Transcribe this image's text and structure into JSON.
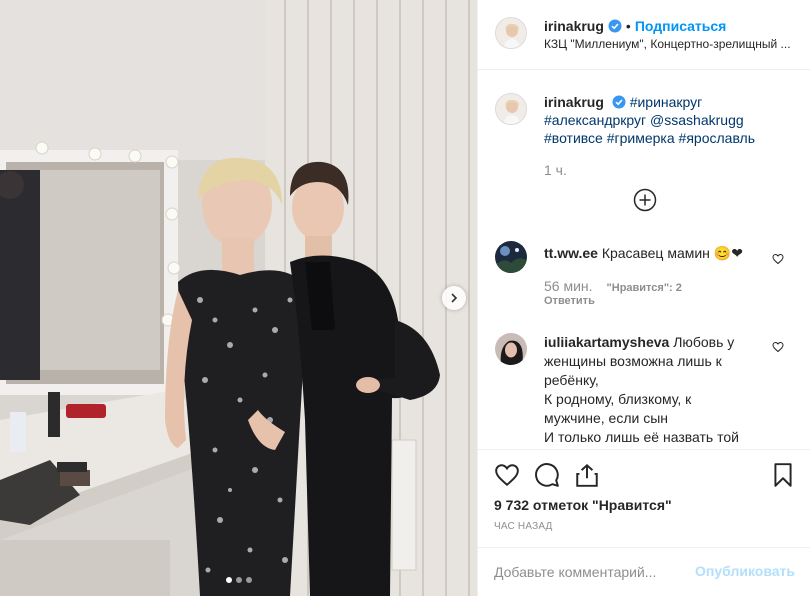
{
  "post": {
    "username": "irinakrug",
    "follow_label": "Подписаться",
    "separator": "•",
    "location": "КЗЦ \"Миллениум\", Концертно-зрелищный ..."
  },
  "caption": {
    "username": "irinakrug",
    "parts": [
      "#иринакруг",
      "#александркруг",
      "@ssashakrugg",
      "#вотивсе",
      "#гримерка",
      "#ярославль"
    ],
    "time": "1 ч."
  },
  "comments": [
    {
      "username": "tt.ww.ee",
      "text": "Красавец мамин 😊❤",
      "time": "56 мин.",
      "likes": "\"Нравится\": 2",
      "reply": "Ответить"
    },
    {
      "username": "iuliiakartamysheva",
      "text_lines": [
        "Любовь у",
        "женщины возможна лишь к",
        "ребёнку,",
        "К родному, близкому, к",
        "мужчине, если сын",
        "И только лишь её назвать той"
      ]
    }
  ],
  "likes_count": "9 732 отметок \"Нравится\"",
  "posted_ago": "ЧАС НАЗАД",
  "add_comment": {
    "placeholder": "Добавьте комментарий...",
    "post_label": "Опубликовать"
  },
  "carousel": {
    "count": 3,
    "active": 0
  },
  "colors": {
    "accent": "#0095f6",
    "link": "#00376b",
    "muted": "#8e8e8e",
    "post_disabled": "#b2dffc"
  },
  "icons": [
    "verified-badge-icon",
    "chevron-right-icon",
    "plus-circle-icon",
    "heart-icon",
    "comment-icon",
    "share-icon",
    "bookmark-icon"
  ]
}
